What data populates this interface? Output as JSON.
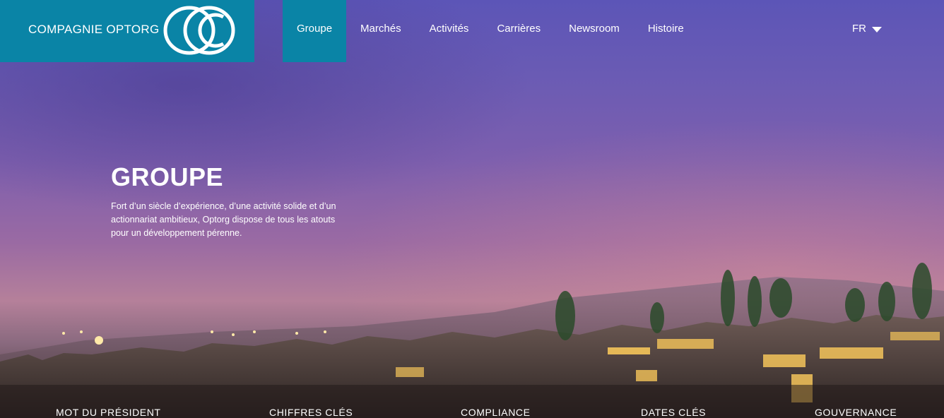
{
  "brand": {
    "name": "COMPAGNIE OPTORG",
    "color": "#0a84a6"
  },
  "nav": {
    "items": [
      {
        "label": "Groupe",
        "active": true
      },
      {
        "label": "Marchés"
      },
      {
        "label": "Activités"
      },
      {
        "label": "Carrières"
      },
      {
        "label": "Newsroom"
      },
      {
        "label": "Histoire"
      }
    ],
    "language": "FR"
  },
  "hero": {
    "title": "GROUPE",
    "description": "Fort d’un siècle d’expérience, d’une activité solide et d’un actionnariat ambitieux, Optorg dispose de tous les atouts pour un développement pérenne."
  },
  "subnav": {
    "items": [
      {
        "label": "MOT DU PRÉSIDENT"
      },
      {
        "label": "CHIFFRES CLÉS"
      },
      {
        "label": "COMPLIANCE"
      },
      {
        "label": "DATES CLÉS"
      },
      {
        "label": "GOUVERNANCE"
      }
    ]
  }
}
